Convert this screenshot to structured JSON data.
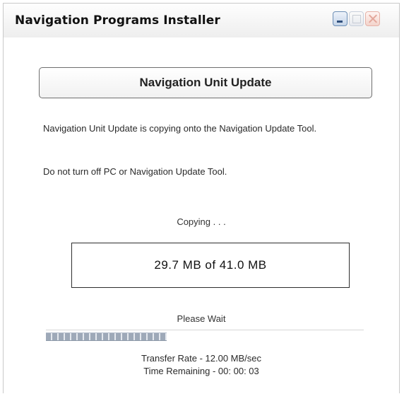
{
  "window": {
    "title": "Navigation Programs Installer",
    "controls": {
      "minimize_icon": "minimize-icon",
      "maximize_icon": "maximize-icon",
      "close_icon": "close-icon"
    }
  },
  "header": {
    "label": "Navigation Unit Update"
  },
  "messages": {
    "copying_info": "Navigation Unit Update is copying onto the Navigation Update Tool.",
    "warning": "Do not turn off PC or Navigation Update Tool."
  },
  "status": {
    "copying_label": "Copying . . .",
    "size_progress": "29.7 MB of 41.0 MB",
    "please_wait": "Please Wait",
    "progress_fraction": 0.38
  },
  "transfer": {
    "rate": "Transfer Rate - 12.00 MB/sec",
    "time_remaining": "Time Remaining - 00: 00: 03"
  },
  "colors": {
    "progress_block": "#9ea9b8",
    "minimize_accent": "#6d8fb6"
  }
}
